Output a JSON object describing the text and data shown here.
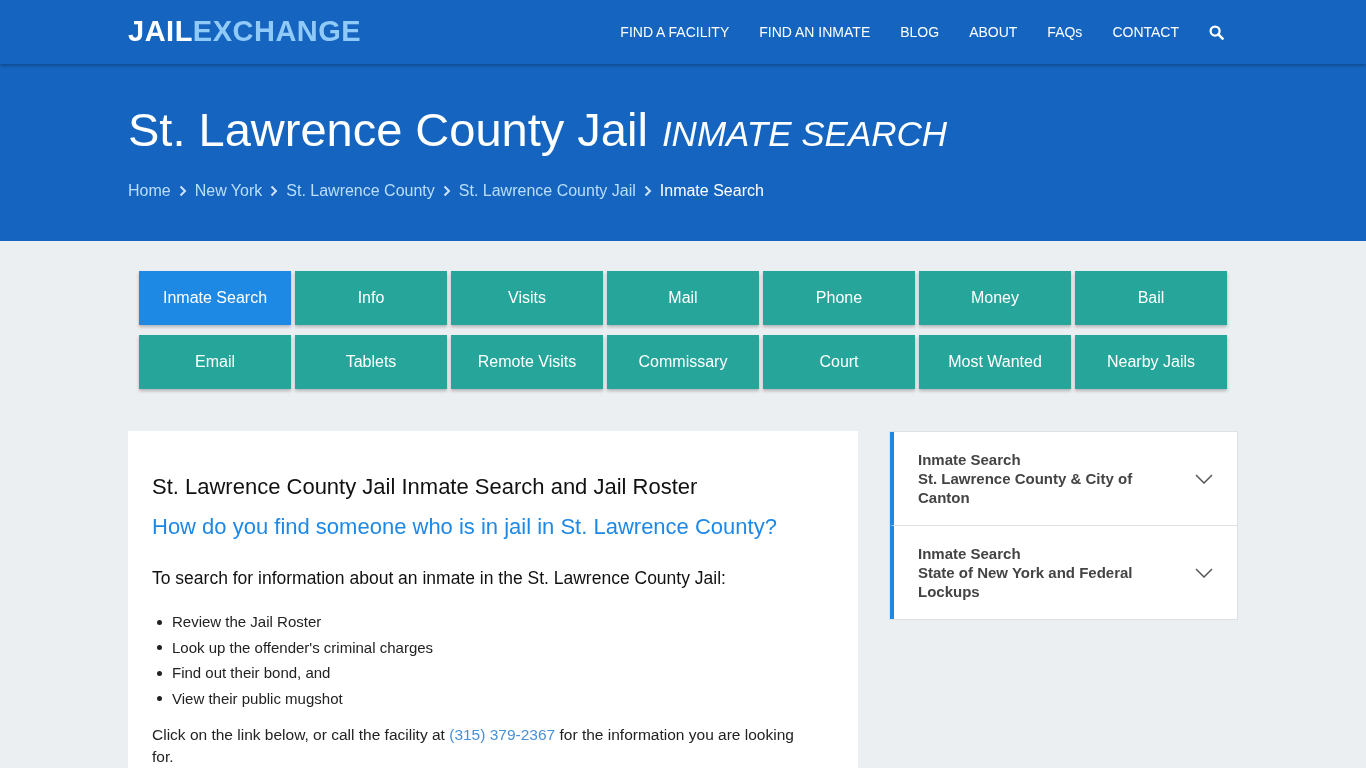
{
  "header": {
    "logo": [
      "JAIL",
      "EXCHANGE"
    ],
    "nav": [
      "FIND A FACILITY",
      "FIND AN INMATE",
      "BLOG",
      "ABOUT",
      "FAQs",
      "CONTACT"
    ]
  },
  "hero": {
    "title": "St. Lawrence County Jail",
    "subtitle": "INMATE SEARCH",
    "breadcrumbs": [
      {
        "label": "Home",
        "current": false
      },
      {
        "label": "New York",
        "current": false
      },
      {
        "label": "St. Lawrence County",
        "current": false
      },
      {
        "label": "St. Lawrence County Jail",
        "current": false
      },
      {
        "label": "Inmate Search",
        "current": true
      }
    ]
  },
  "tabs": [
    {
      "label": "Inmate Search",
      "selected": true
    },
    {
      "label": "Info",
      "selected": false
    },
    {
      "label": "Visits",
      "selected": false
    },
    {
      "label": "Mail",
      "selected": false
    },
    {
      "label": "Phone",
      "selected": false
    },
    {
      "label": "Money",
      "selected": false
    },
    {
      "label": "Bail",
      "selected": false
    },
    {
      "label": "Email",
      "selected": false
    },
    {
      "label": "Tablets",
      "selected": false
    },
    {
      "label": "Remote Visits",
      "selected": false
    },
    {
      "label": "Commissary",
      "selected": false
    },
    {
      "label": "Court",
      "selected": false
    },
    {
      "label": "Most Wanted",
      "selected": false
    },
    {
      "label": "Nearby Jails",
      "selected": false
    }
  ],
  "article": {
    "heading": "St. Lawrence County Jail Inmate Search and Jail Roster",
    "question": "How do you find someone who is in jail in St. Lawrence County?",
    "lead": "To search for information about an inmate in the St. Lawrence County Jail:",
    "bullets": [
      "Review the Jail Roster",
      "Look up the offender's criminal charges",
      "Find out their bond, and",
      "View their public mugshot"
    ],
    "paragraph": {
      "before": "Click on the link below, or call the facility at",
      "link": "(315) 379-2367",
      "after": "for the information you are looking for."
    }
  },
  "sidebar": {
    "items": [
      {
        "title": "Inmate Search",
        "subtitle": "St. Lawrence County & City of Canton",
        "expanded": false
      },
      {
        "title": "Inmate Search",
        "subtitle": "State of New York and Federal Lockups",
        "expanded": false
      }
    ]
  }
}
